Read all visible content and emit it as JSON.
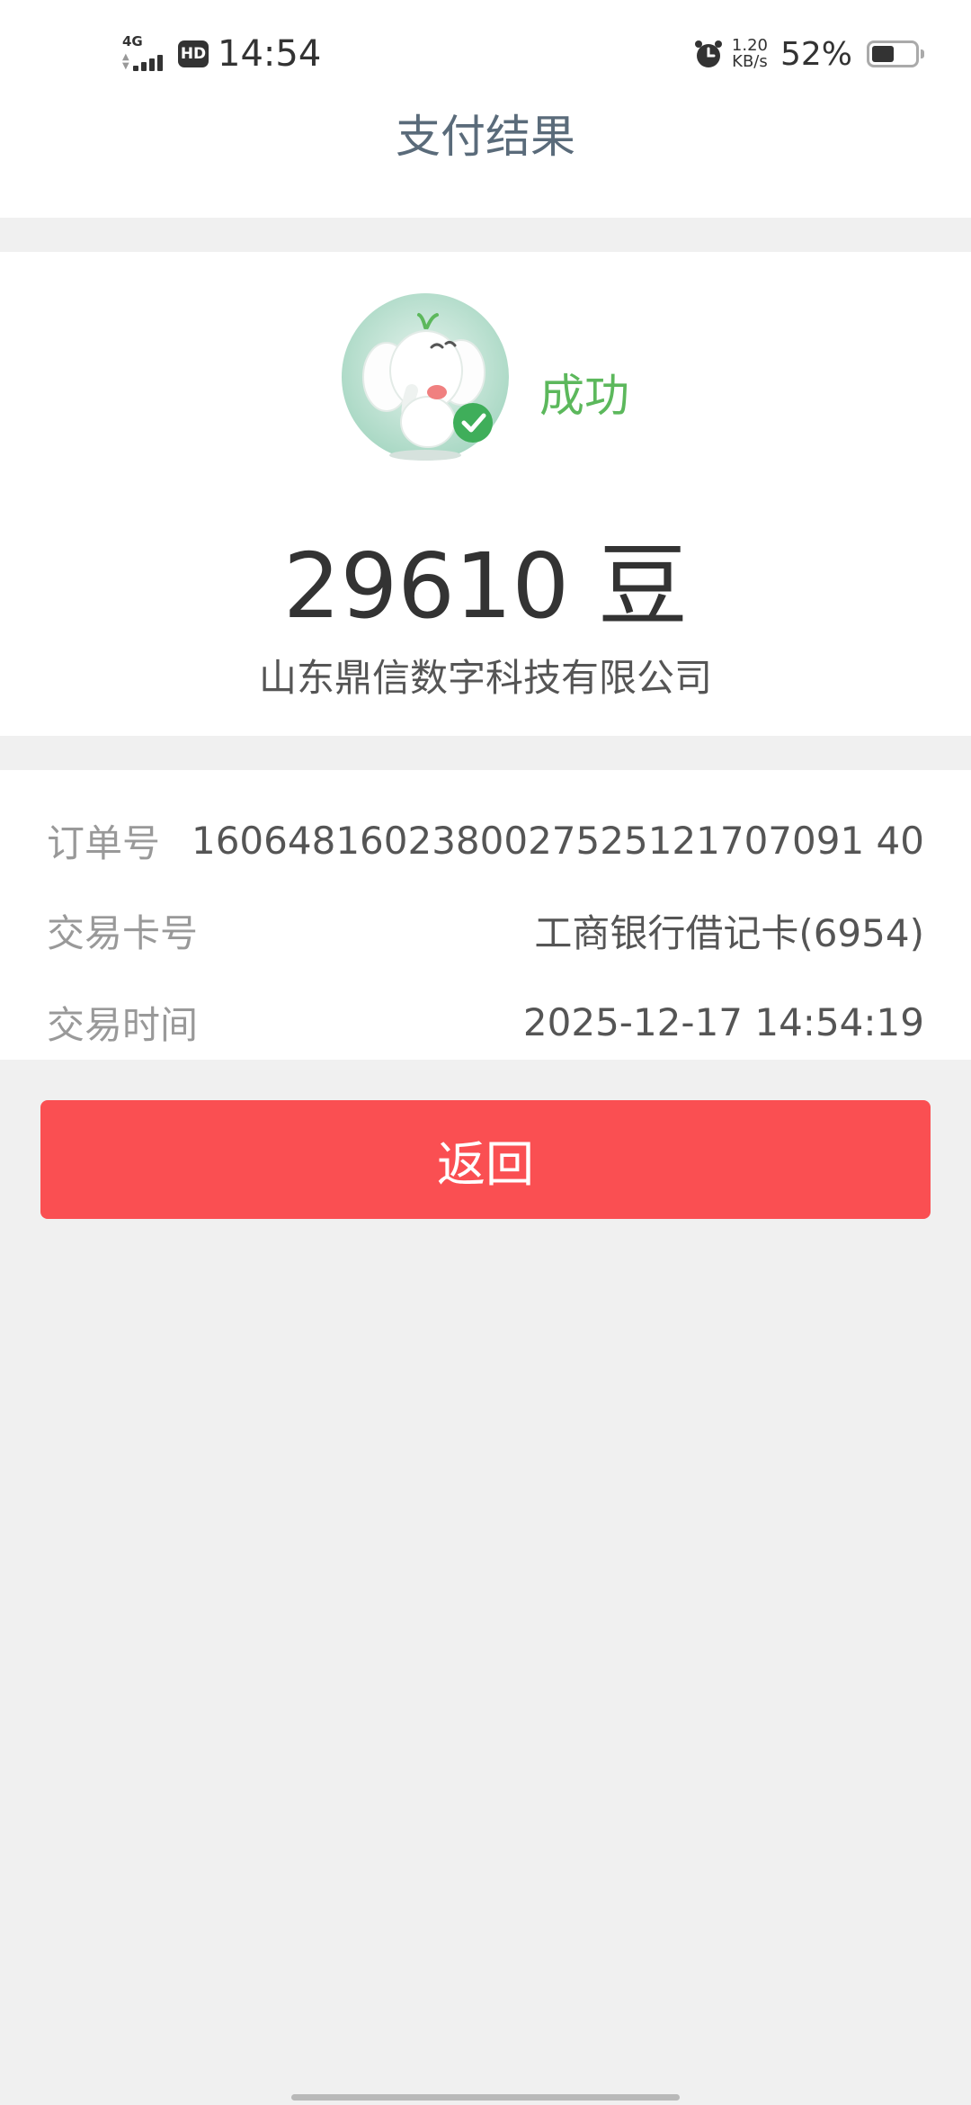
{
  "status_bar": {
    "network": "4G",
    "hd": "HD",
    "time": "14:54",
    "speed_value": "1.20",
    "speed_unit": "KB/s",
    "battery_percent": "52%",
    "battery_level": 0.52
  },
  "header": {
    "title": "支付结果"
  },
  "result": {
    "status": "成功",
    "amount": "29610 豆",
    "merchant": "山东鼎信数字科技有限公司",
    "success_color": "#5cb85c"
  },
  "details": {
    "rows": [
      {
        "label": "订单号",
        "value": "1606481602380027525121707091 40"
      },
      {
        "label": "交易卡号",
        "value": "工商银行借记卡(6954)"
      },
      {
        "label": "交易时间",
        "value": "2025-12-17 14:54:19"
      }
    ]
  },
  "actions": {
    "back_label": "返回",
    "back_color": "#fa4f52"
  }
}
